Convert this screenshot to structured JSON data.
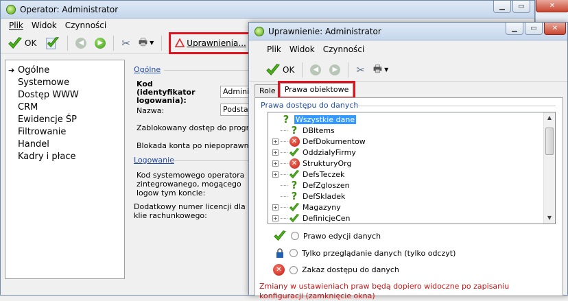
{
  "main": {
    "title": "Operator: Administrator",
    "menu": [
      "Plik",
      "Widok",
      "Czynności"
    ],
    "toolbar": {
      "ok_label": "OK",
      "uprawnienia_label": "Uprawnienia..."
    },
    "nav": [
      "Ogólne",
      "Systemowe",
      "Dostęp WWW",
      "CRM",
      "Ewidencje ŚP",
      "Filtrowanie",
      "Handel",
      "Kadry i płace"
    ],
    "sections": {
      "general": "Ogólne",
      "login": "Logowanie"
    },
    "fields": {
      "kod_label": "Kod (identyfikator logowania):",
      "kod_value": "Administ",
      "nazwa_label": "Nazwa:",
      "nazwa_value": "Podstaw",
      "zablokowany": "Zablokowany dostęp do programu",
      "blokada": "Blokada konta po niepoprawnym",
      "kod_sys": "Kod systemowego operatora zintegrowanego, mogącego logow tym koncie:",
      "licencja": "Dodatkowy numer licencji dla klie rachunkowego:"
    }
  },
  "dialog": {
    "title": "Uprawnienie: Administrator",
    "menu": [
      "Plik",
      "Widok",
      "Czynności"
    ],
    "toolbar": {
      "ok_label": "OK"
    },
    "tabs": [
      "Role",
      "Prawa obiektowe"
    ],
    "group_label": "Prawa dostępu do danych",
    "tree": [
      {
        "label": "Wszystkie dane",
        "icon": "question",
        "expander": false,
        "selected": true,
        "indent": 0
      },
      {
        "label": "DBItems",
        "icon": "question",
        "expander": false,
        "selected": false,
        "indent": 1
      },
      {
        "label": "DefDokumentow",
        "icon": "deny",
        "expander": true,
        "selected": false,
        "indent": 1
      },
      {
        "label": "OddzialyFirmy",
        "icon": "allow",
        "expander": true,
        "selected": false,
        "indent": 1
      },
      {
        "label": "StrukturyOrg",
        "icon": "deny",
        "expander": true,
        "selected": false,
        "indent": 1
      },
      {
        "label": "DefsTeczek",
        "icon": "allow",
        "expander": true,
        "selected": false,
        "indent": 1
      },
      {
        "label": "DefZgloszen",
        "icon": "question",
        "expander": false,
        "selected": false,
        "indent": 1
      },
      {
        "label": "DefSkladek",
        "icon": "question",
        "expander": false,
        "selected": false,
        "indent": 1
      },
      {
        "label": "Magazyny",
        "icon": "allow",
        "expander": true,
        "selected": false,
        "indent": 1
      },
      {
        "label": "DefinicjeCen",
        "icon": "allow",
        "expander": true,
        "selected": false,
        "indent": 1
      }
    ],
    "options": [
      {
        "label": "Prawo edycji danych",
        "icon": "check-icon"
      },
      {
        "label": "Tylko przeglądanie danych (tylko odczyt)",
        "icon": "lock-icon"
      },
      {
        "label": "Zakaz dostępu do danych",
        "icon": "deny-icon"
      }
    ],
    "warning": "Zmiany w ustawieniach praw będą dopiero widoczne po zapisaniu konfiguracji (zamknięcie okna)"
  },
  "colors": {
    "highlight": "#e0141e",
    "selection": "#3399ff",
    "section_link": "#1f4aa8",
    "warning": "#d21111"
  }
}
